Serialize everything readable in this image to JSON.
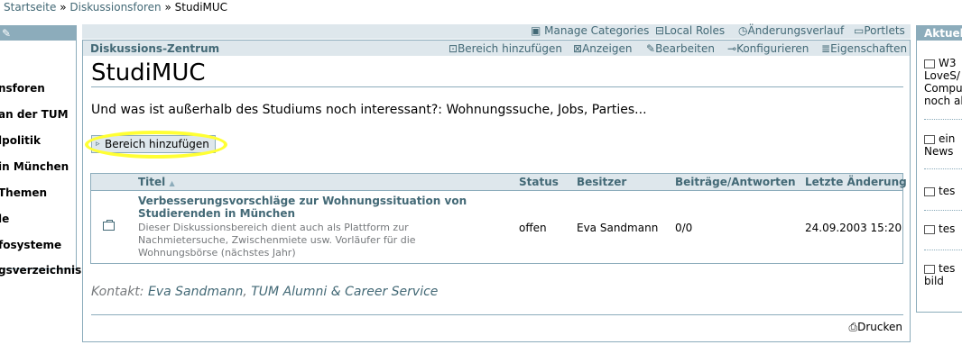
{
  "breadcrumb": {
    "items": [
      "Startseite",
      "Diskussionsforen",
      "StudiMUC"
    ],
    "separator": "»"
  },
  "left_portlet": {
    "items": [
      "nsforen",
      "an der TUM",
      "lpolitik",
      "in München",
      "Themen",
      "le",
      "fosysteme",
      "gsverzeichnis"
    ]
  },
  "actions_bar": {
    "manage_categories": "Manage Categories",
    "local_roles": "Local Roles",
    "history": "Änderungsverlauf",
    "portlets": "Portlets"
  },
  "content_tabs": {
    "title": "Diskussions-Zentrum",
    "add_area": "Bereich hinzufügen",
    "view": "Anzeigen",
    "edit": "Bearbeiten",
    "configure": "Konfigurieren",
    "properties": "Eigenschaften"
  },
  "page": {
    "title": "StudiMUC",
    "description": "Und was ist außerhalb des Studiums noch interessant?: Wohnungssuche, Jobs, Parties...",
    "add_button": "Bereich hinzufügen"
  },
  "table": {
    "columns": [
      "Titel",
      "Status",
      "Besitzer",
      "Beiträge/Antworten",
      "Letzte Änderung"
    ],
    "sort_indicator": "▲",
    "rows": [
      {
        "title": "Verbesserungsvorschläge zur Wohnungssituation von Studierenden in München",
        "description": "Dieser Diskussionsbereich dient auch als Plattform zur Nachmietersuche, Zwischenmiete usw. Vorläufer für die Wohnungsbörse (nächstes Jahr)",
        "status": "offen",
        "owner": "Eva Sandmann",
        "posts": "0/0",
        "modified": "24.09.2003 15:20"
      }
    ]
  },
  "contact": {
    "label": "Kontakt:",
    "person": "Eva Sandmann",
    "separator": ",",
    "org": "TUM Alumni & Career Service"
  },
  "print_label": "Drucken",
  "right_portlet": {
    "head": "Aktuell",
    "items": [
      "W3 LoveS/ Compu noch al",
      "ein News",
      "tes",
      "tes",
      "tes bild"
    ]
  },
  "colors": {
    "accent": "#8cacbb",
    "light": "#dee7ec",
    "link": "#436976",
    "highlight": "#ffff33"
  }
}
